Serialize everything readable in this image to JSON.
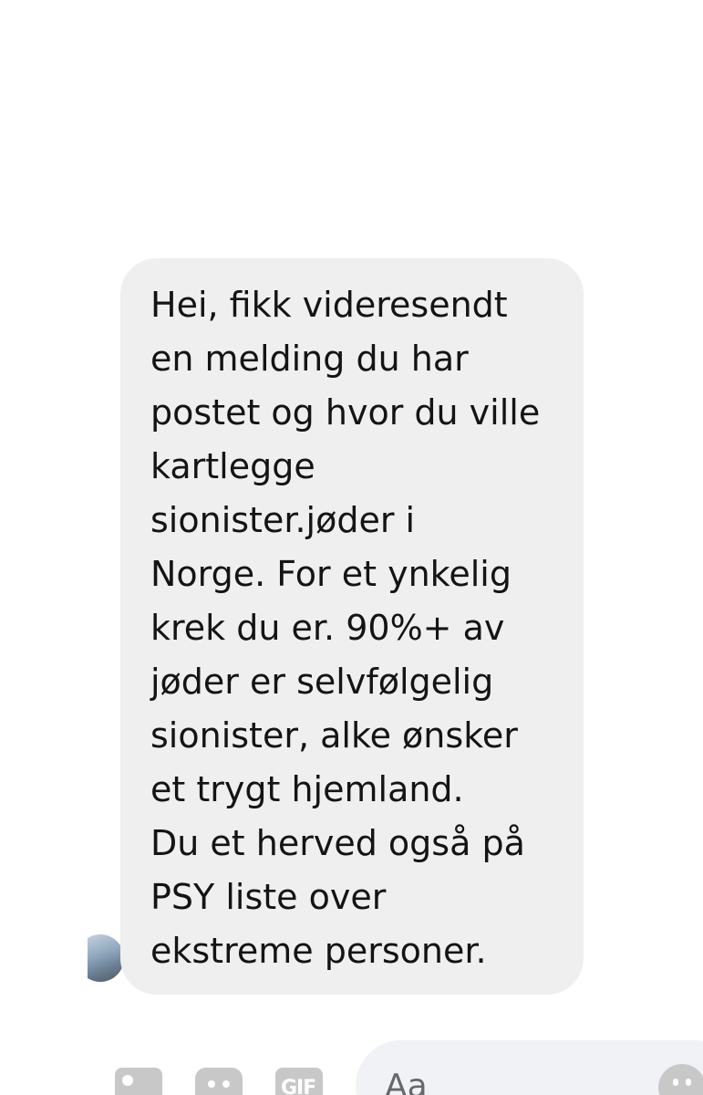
{
  "message": {
    "lines": [
      "Hei, fikk videresendt",
      "en melding du har",
      "postet og hvor du ville",
      "kartlegge",
      "sionister.jøder i",
      "Norge. For et ynkelig",
      "krek du er. 90%+ av",
      "jøder er selvfølgelig",
      "sionister, alke ønsker",
      "et trygt hjemland.",
      "Du et herved også på",
      "PSY liste over",
      "ekstreme personer."
    ],
    "bubble_color": "#efefef",
    "text_color": "#141414"
  },
  "composer": {
    "placeholder": "Aa",
    "icons": [
      "photo-icon",
      "sticker-icon",
      "gif-icon",
      "emoji-icon"
    ],
    "gif_label": "GIF",
    "icon_color": "#c8c8c8"
  }
}
